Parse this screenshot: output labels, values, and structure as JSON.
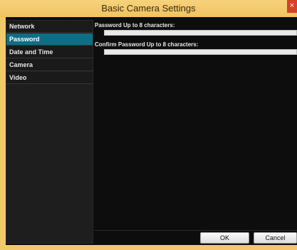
{
  "window": {
    "title": "Basic Camera Settings",
    "close_glyph": "×"
  },
  "sidebar": {
    "items": [
      {
        "label": "Network",
        "active": false
      },
      {
        "label": "Password",
        "active": true
      },
      {
        "label": "Date and Time",
        "active": false
      },
      {
        "label": "Camera",
        "active": false
      },
      {
        "label": "Video",
        "active": false
      }
    ]
  },
  "form": {
    "password_label": "Password  Up to 8 characters:",
    "password_value": "",
    "confirm_label": "Confirm Password  Up to 8 characters:",
    "confirm_value": ""
  },
  "footer": {
    "ok_label": "OK",
    "cancel_label": "Cancel"
  },
  "colors": {
    "accent": "#0e6e86",
    "frame": "#f0c96a",
    "panel": "#0d0d0d"
  }
}
